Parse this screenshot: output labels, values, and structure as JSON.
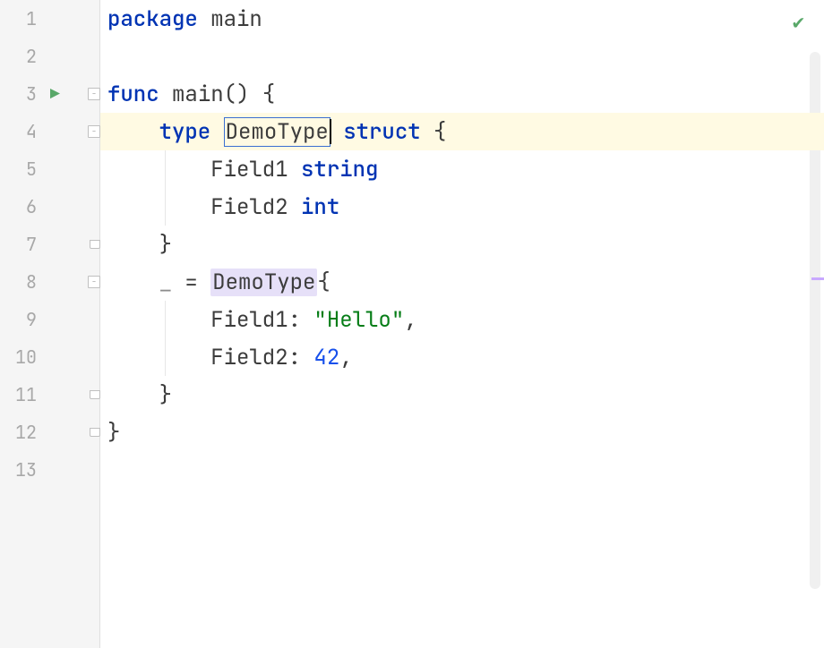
{
  "lines": {
    "l1": "1",
    "l2": "2",
    "l3": "3",
    "l4": "4",
    "l5": "5",
    "l6": "6",
    "l7": "7",
    "l8": "8",
    "l9": "9",
    "l10": "10",
    "l11": "11",
    "l12": "12",
    "l13": "13"
  },
  "code": {
    "kw_package": "package",
    "pkg_name": "main",
    "kw_func": "func",
    "func_name": "main",
    "paren_open": "()",
    "brace_open": "{",
    "brace_close": "}",
    "kw_type": "type",
    "type_name": "DemoType",
    "kw_struct": "struct",
    "field1_name": "Field1",
    "field1_type": "string",
    "field2_name": "Field2",
    "field2_type": "int",
    "blank_ident": "_",
    "eq": " = ",
    "type_use": "DemoType",
    "field1_label": "Field1:",
    "field1_value": "\"Hello\"",
    "comma": ",",
    "field2_label": "Field2:",
    "field2_value": "42"
  },
  "indent": {
    "one": "    ",
    "two": "        "
  }
}
